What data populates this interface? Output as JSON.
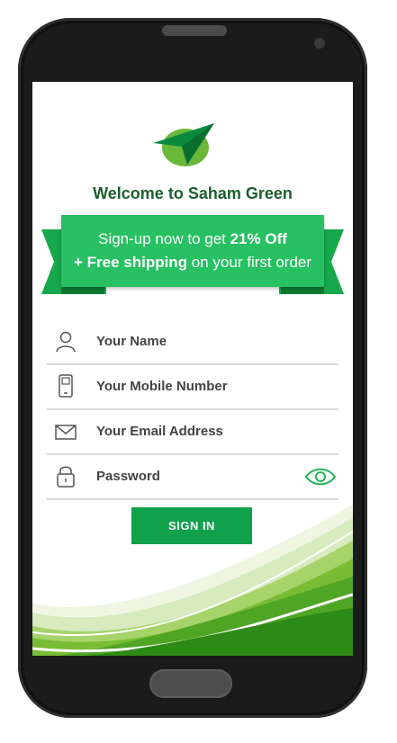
{
  "app": {
    "title": "Welcome to Saham Green"
  },
  "promo": {
    "line1_prefix": "Sign-up now to get ",
    "line1_bold": "21% Off",
    "line2_bold": "+ Free shipping",
    "line2_suffix": " on your first order"
  },
  "form": {
    "name_placeholder": "Your Name",
    "mobile_placeholder": "Your Mobile Number",
    "email_placeholder": "Your Email Address",
    "password_placeholder": "Password"
  },
  "actions": {
    "signin_label": "SIGN IN"
  },
  "colors": {
    "brand_green": "#0fa14c",
    "ribbon_green": "#27c062",
    "title_green": "#1b5e2f"
  },
  "icons": [
    "user-icon",
    "phone-icon",
    "mail-icon",
    "lock-icon",
    "eye-icon",
    "logo-icon"
  ]
}
